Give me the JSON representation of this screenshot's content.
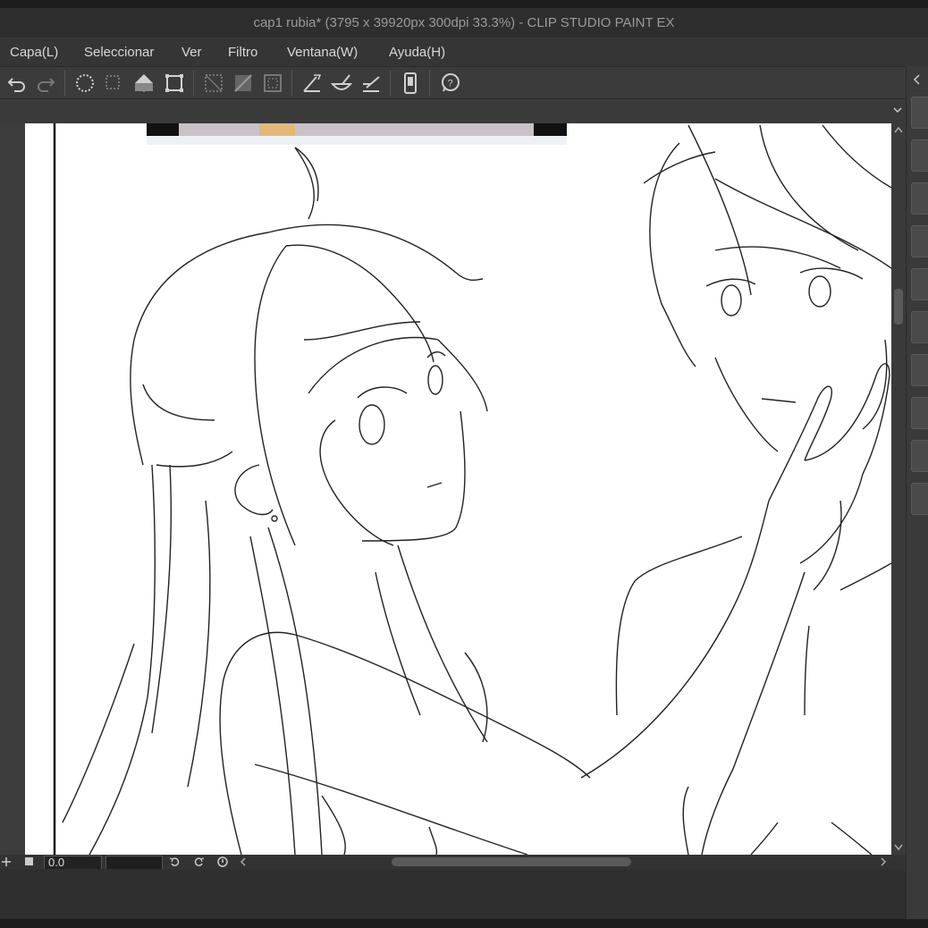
{
  "window": {
    "title": "cap1 rubia* (3795 x 39920px 300dpi 33.3%)  - CLIP STUDIO PAINT EX"
  },
  "menu": {
    "items": [
      {
        "label": "Capa(L)"
      },
      {
        "label": "Seleccionar"
      },
      {
        "label": "Ver"
      },
      {
        "label": "Filtro"
      },
      {
        "label": "Ventana(W)"
      },
      {
        "label": "Ayuda(H)"
      }
    ]
  },
  "toolbar": {
    "icons": [
      "undo-icon",
      "redo-icon",
      "select-all-icon",
      "deselect-icon",
      "fill-selection-icon",
      "transform-icon",
      "clear-icon",
      "clear-outside-icon",
      "invert-selection-icon",
      "ruler-icon",
      "brush-ruler-icon",
      "snap-ruler-icon",
      "smartphone-icon",
      "help-icon"
    ]
  },
  "status": {
    "rotation_value": "0.0"
  },
  "colors": {
    "bg": "#2b2b2b",
    "toolbar": "#3b3b3b",
    "canvas": "#ffffff"
  }
}
